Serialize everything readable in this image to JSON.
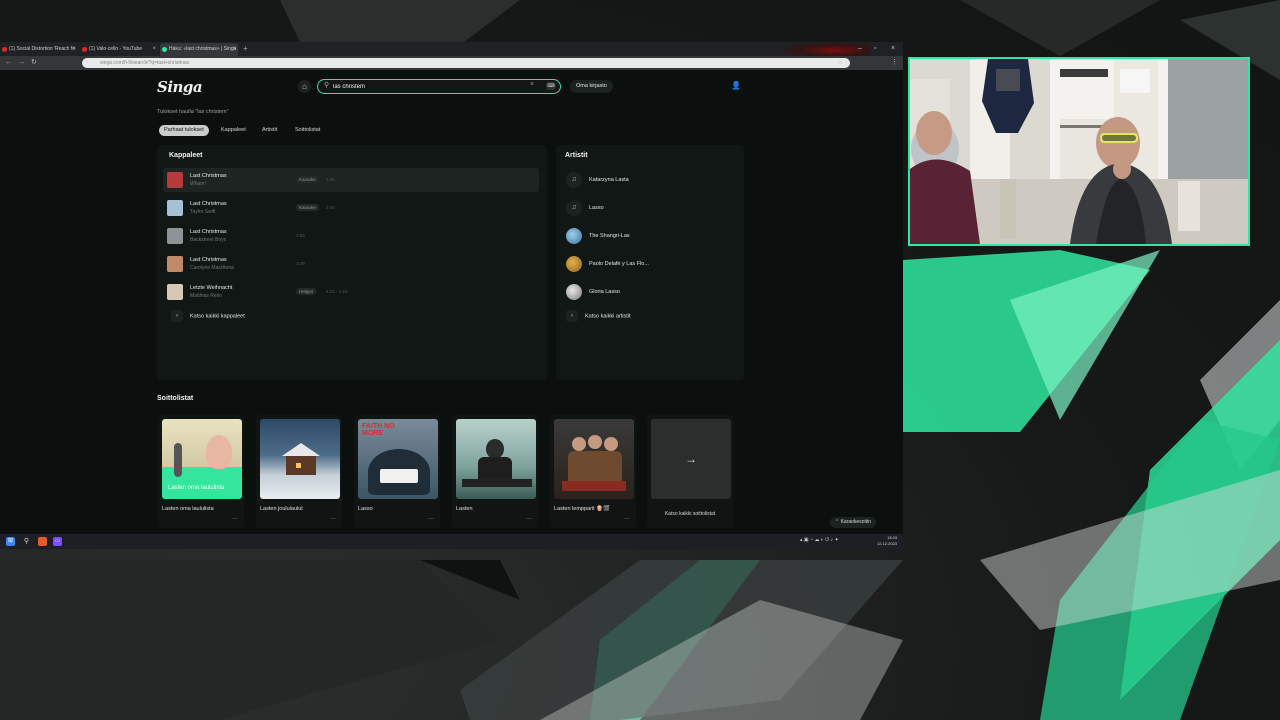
{
  "browser": {
    "tabs": [
      {
        "label": "(1) Social Distortion 'Reach fo",
        "favicon_color": "#e0281e"
      },
      {
        "label": "(1) Valo-cello - YouTube",
        "favicon_color": "#e0281e"
      },
      {
        "label": "Haku: «last christmas» | Singa",
        "favicon_color": "#2ee7a0"
      }
    ],
    "url": "singa.com/fi-fi/search/?q=last+christmas",
    "icons": {
      "back": "arrow-left-icon",
      "forward": "arrow-right-icon",
      "reload": "reload-icon",
      "new_tab": "plus-icon",
      "minimize": "minimize-icon",
      "maximize": "maximize-icon",
      "close": "close-icon"
    }
  },
  "header": {
    "logo": "Singa",
    "search": {
      "value": "las christem",
      "placeholder": ""
    },
    "library_button": "Oma kirjasto",
    "icons": {
      "home": "home-icon",
      "search": "search-icon",
      "clear": "close-icon",
      "keyboard": "keyboard-icon",
      "user": "user-icon"
    }
  },
  "results_label": "Tulokset haulla \"las christem\"",
  "filters": [
    "Parhaat tulokset",
    "Kappaleet",
    "Artistit",
    "Soittolistat"
  ],
  "active_filter": "Parhaat tulokset",
  "songs": {
    "title": "Kappaleet",
    "items": [
      {
        "title": "Last Christmas",
        "artist": "Wham!",
        "tag": "Karaoke",
        "duration": "4:36",
        "thumb": "#b73a3a"
      },
      {
        "title": "Last Christmas",
        "artist": "Taylor Swift",
        "tag": "Karaoke",
        "duration": "3:56",
        "thumb": "#a7c0d6"
      },
      {
        "title": "Last Christmas",
        "artist": "Backstreet Boys",
        "tag": "",
        "duration": "3:58",
        "thumb": "#8c9496"
      },
      {
        "title": "Last Christmas",
        "artist": "Carolyne Mas/Anna",
        "tag": "",
        "duration": "3:49",
        "thumb": "#c38a6a"
      },
      {
        "title": "Letzte Weihnacht",
        "artist": "Matthias Reim",
        "tag": "Helppo",
        "duration": "4:21 · 1:15",
        "thumb": "#d5c7b6"
      }
    ],
    "see_all": "Katso kaikki kappaleet"
  },
  "artists": {
    "title": "Artistit",
    "items": [
      {
        "name": "Katarzyna Lasta",
        "avatar": "music-note-icon"
      },
      {
        "name": "Lasso",
        "avatar": "music-note-icon"
      },
      {
        "name": "The Shangri-Las",
        "avatar": "photo"
      },
      {
        "name": "Paolo Delafé y Las Flo...",
        "avatar": "photo"
      },
      {
        "name": "Gloria Lasso",
        "avatar": "photo"
      }
    ],
    "see_all": "Katso kaikki artistit"
  },
  "playlists": {
    "title": "Soittolistat",
    "items": [
      {
        "name": "Lasten oma laululista",
        "overlay_text": "Lasten oma laululista"
      },
      {
        "name": "Lasten joululaulut",
        "overlay_text": ""
      },
      {
        "name": "Lasso",
        "overlay_text": "FAITH NO MORE"
      },
      {
        "name": "Lasten",
        "overlay_text": ""
      },
      {
        "name": "Lasten lempparit 🍿🎬",
        "overlay_text": ""
      }
    ],
    "see_all": "Katso kaikki soittolistat"
  },
  "karaoke_button": "Karaokesoitin",
  "taskbar": {
    "time": "13:43",
    "date": "12.12.2023"
  },
  "colors": {
    "accent": "#2ee7a0",
    "page_bg": "#0b0f0e",
    "panel_bg": "#111715"
  }
}
